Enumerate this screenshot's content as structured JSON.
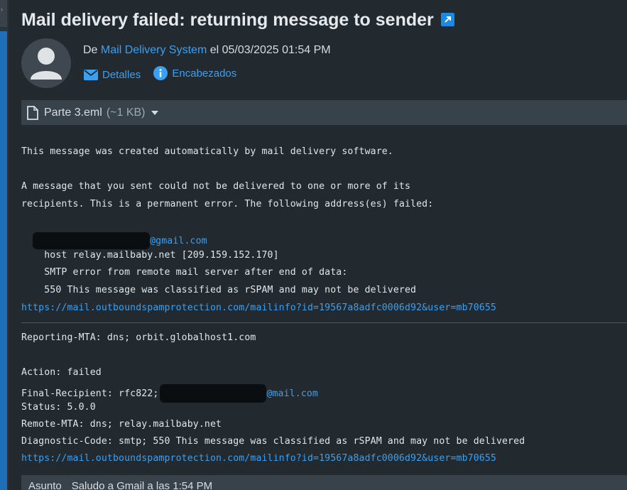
{
  "message": {
    "subject": "Mail delivery failed: returning message to sender",
    "from_prefix": "De ",
    "sender": "Mail Delivery System",
    "date_text": " el 05/03/2025 01:54 PM",
    "actions": {
      "details": "Detalles",
      "headers": "Encabezados"
    }
  },
  "attachment": {
    "name": "Parte 3.eml",
    "size": "(~1 KB)"
  },
  "body": {
    "line1": "This message was created automatically by mail delivery software.",
    "line2": "A message that you sent could not be delivered to one or more of its",
    "line3": "recipients. This is a permanent error. The following address(es) failed:",
    "recipient_tail": "@gmail.com",
    "host_line": "    host relay.mailbaby.net [209.159.152.170]",
    "smtp_line": "    SMTP error from remote mail server after end of data:",
    "code_line": "    550 This message was classified as rSPAM and may not be delivered",
    "url": "https://mail.outboundspamprotection.com/mailinfo?id=19567a8adfc0006d92&user=mb70655",
    "reporting_mta": "Reporting-MTA: dns; orbit.globalhost1.com",
    "action": "Action: failed",
    "final_recipient_prefix": "Final-Recipient: rfc822;",
    "final_recipient_tail": "@mail.com",
    "status": "Status: 5.0.0",
    "remote_mta": "Remote-MTA: dns; relay.mailbaby.net",
    "diagnostic": "Diagnostic-Code: smtp; 550 This message was classified as rSPAM and may not be delivered",
    "url2": "https://mail.outboundspamprotection.com/mailinfo?id=19567a8adfc0006d92&user=mb70655"
  },
  "footer": {
    "label": "Asunto",
    "value": "Saludo a Gmail a las 1:54 PM"
  },
  "colors": {
    "background": "#222a30",
    "link": "#3aa0f2",
    "accent_bar": "#1e6fb8",
    "attachment_bar": "#38424a"
  },
  "icons": {
    "external": "open-external-icon",
    "avatar": "person-avatar-icon",
    "details": "envelope-icon",
    "headers": "info-icon",
    "attachment": "file-icon",
    "dropdown": "caret-down-icon"
  }
}
